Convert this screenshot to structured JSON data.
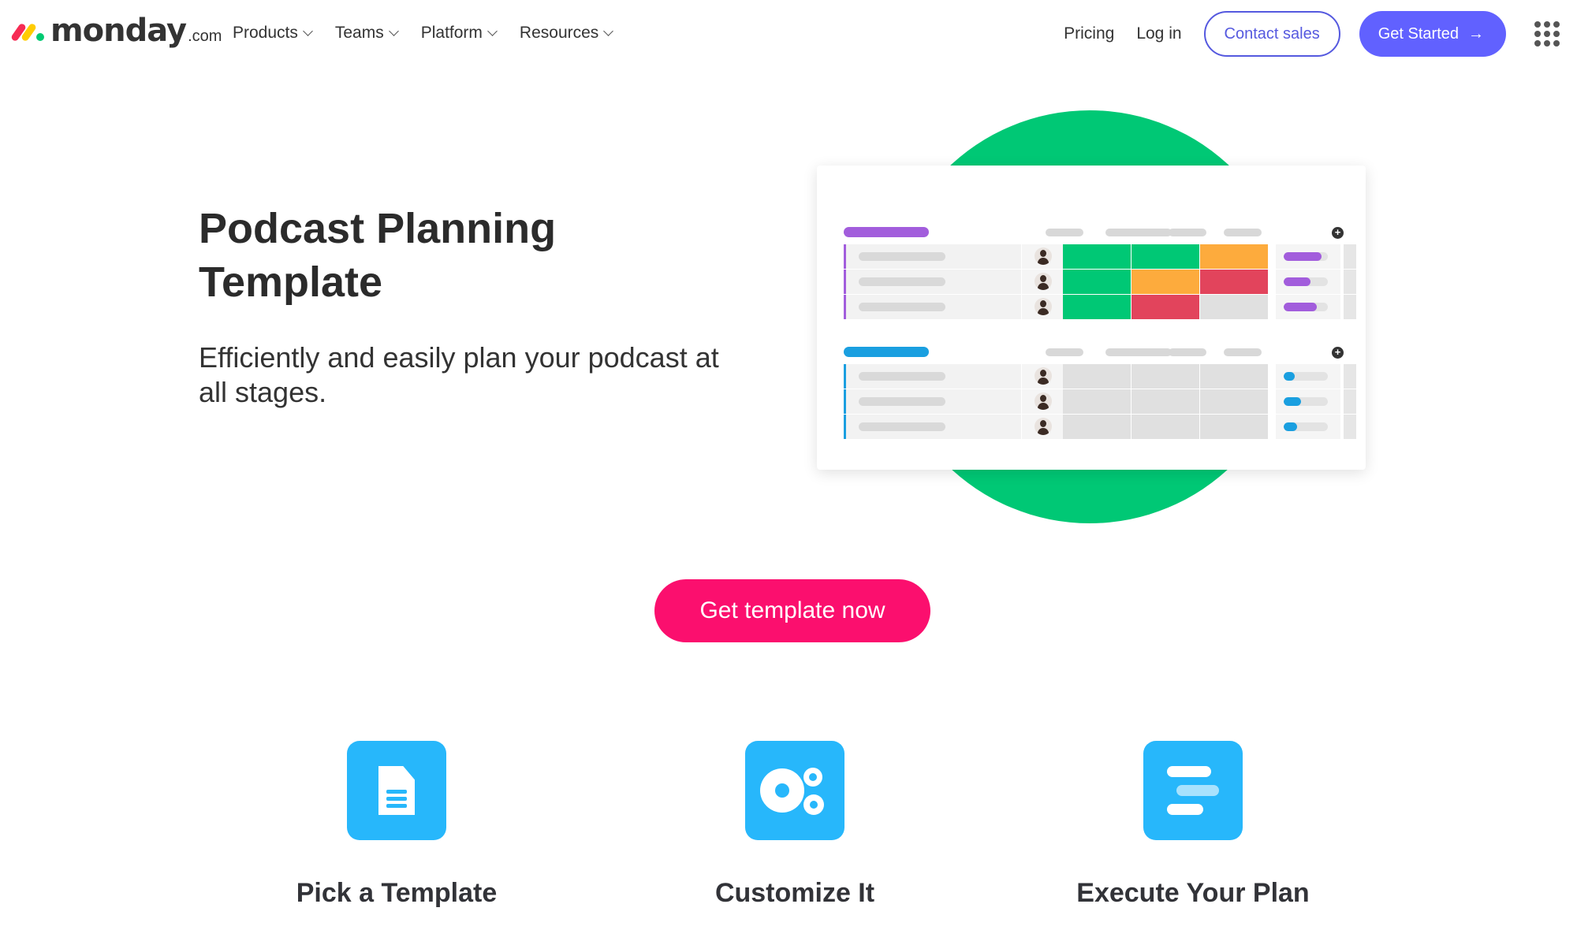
{
  "brand": {
    "name": "monday",
    "tld": ".com",
    "colors": {
      "red": "#f62b54",
      "yellow": "#ffcc00",
      "green": "#00ca72"
    }
  },
  "nav": {
    "items": [
      {
        "label": "Products"
      },
      {
        "label": "Teams"
      },
      {
        "label": "Platform"
      },
      {
        "label": "Resources"
      }
    ],
    "pricing": "Pricing",
    "login": "Log in",
    "contact_sales": "Contact sales",
    "get_started": "Get Started",
    "get_started_icon": "arrow-right-icon",
    "apps_icon": "apps-grid-icon"
  },
  "hero": {
    "title": "Podcast Planning Template",
    "subtitle": "Efficiently and easily plan your podcast at all stages.",
    "cta": "Get template now",
    "colors": {
      "circle": "#00c875",
      "cta": "#fb0f6e"
    }
  },
  "board_preview": {
    "groups": [
      {
        "color": "#a25ddc",
        "rows": [
          {
            "statuses": [
              "#00c875",
              "#00c875",
              "#fdab3d"
            ],
            "progress": 0.85
          },
          {
            "statuses": [
              "#00c875",
              "#fdab3d",
              "#e2445c"
            ],
            "progress": 0.6
          },
          {
            "statuses": [
              "#00c875",
              "#e2445c",
              "#e0e0e0"
            ],
            "progress": 0.75
          }
        ]
      },
      {
        "color": "#1a9fe0",
        "rows": [
          {
            "statuses": [
              "#e0e0e0",
              "#e0e0e0",
              "#e0e0e0"
            ],
            "progress": 0.25
          },
          {
            "statuses": [
              "#e0e0e0",
              "#e0e0e0",
              "#e0e0e0"
            ],
            "progress": 0.4
          },
          {
            "statuses": [
              "#e0e0e0",
              "#e0e0e0",
              "#e0e0e0"
            ],
            "progress": 0.3
          }
        ]
      }
    ]
  },
  "steps": [
    {
      "title": "Pick a Template",
      "icon": "document-icon"
    },
    {
      "title": "Customize It",
      "icon": "gears-icon"
    },
    {
      "title": "Execute Your Plan",
      "icon": "plan-bars-icon"
    }
  ]
}
